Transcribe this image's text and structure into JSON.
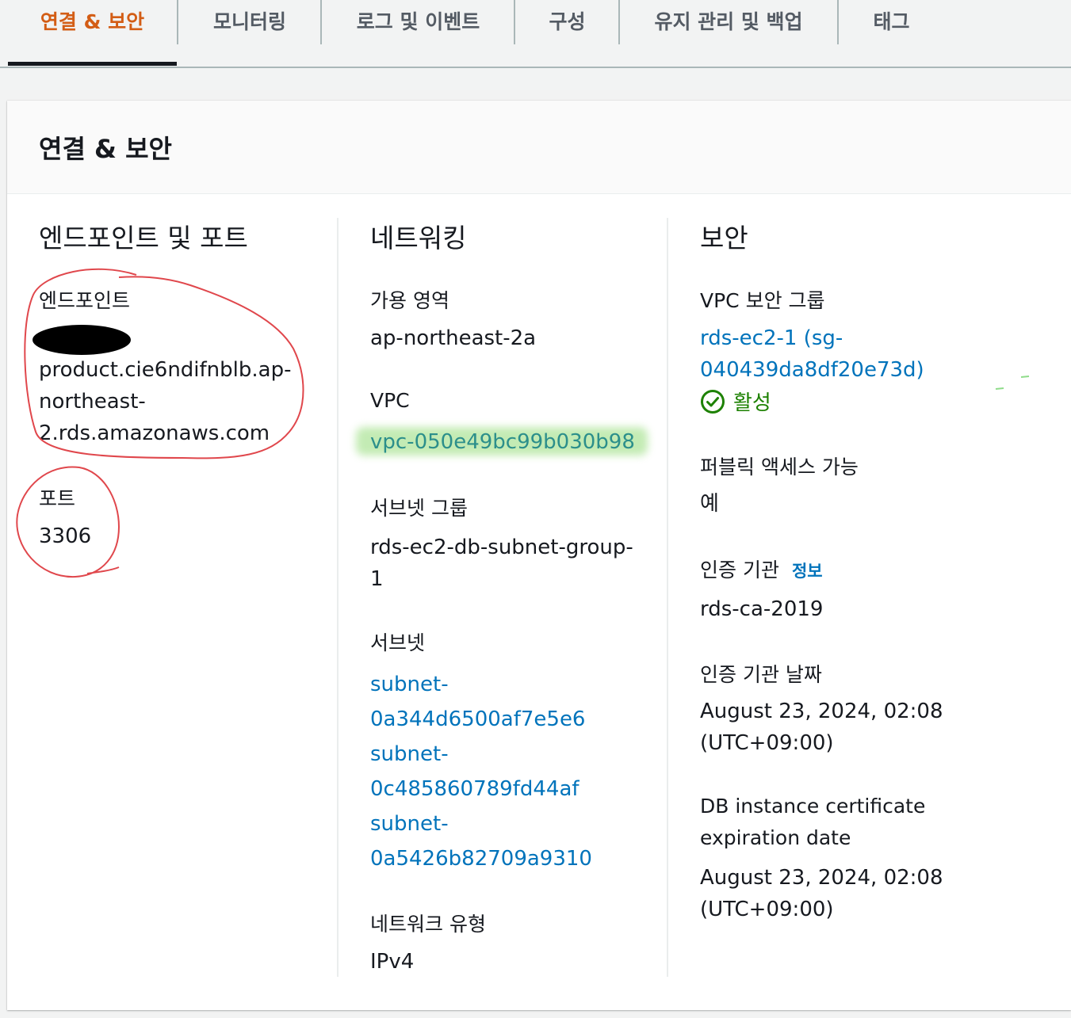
{
  "tabs": [
    {
      "label": "연결 & 보안"
    },
    {
      "label": "모니터링"
    },
    {
      "label": "로그 및 이벤트"
    },
    {
      "label": "구성"
    },
    {
      "label": "유지 관리 및 백업"
    },
    {
      "label": "태그"
    }
  ],
  "active_tab": "연결 & 보안",
  "accent_color": "#d35d15",
  "link_color": "#0073bb",
  "status_color": "#1d8102",
  "card": {
    "title": "연결 & 보안",
    "endpoint_section": {
      "title": "엔드포인트 및 포트",
      "endpoint_label": "엔드포인트",
      "endpoint_line1": "product.cie6ndifnblb.ap-",
      "endpoint_line2": "northeast-",
      "endpoint_line3": "2.rds.amazonaws.com",
      "port_label": "포트",
      "port_value": "3306"
    },
    "networking_section": {
      "title": "네트워킹",
      "az_label": "가용 영역",
      "az_value": "ap-northeast-2a",
      "vpc_label": "VPC",
      "vpc_value": "vpc-050e49bc99b030b98",
      "subnet_group_label": "서브넷 그룹",
      "subnet_group_line1": "rds-ec2-db-subnet-group-",
      "subnet_group_line2": "1",
      "subnet_label": "서브넷",
      "subnets": [
        {
          "line1": "subnet-",
          "line2": "0a344d6500af7e5e6"
        },
        {
          "line1": "subnet-",
          "line2": "0c485860789fd44af"
        },
        {
          "line1": "subnet-",
          "line2": "0a5426b82709a9310"
        }
      ],
      "network_type_label": "네트워크 유형",
      "network_type_value": "IPv4"
    },
    "security_section": {
      "title": "보안",
      "vpc_sg_label": "VPC 보안 그룹",
      "sg_line1": "rds-ec2-1 (sg-",
      "sg_line2": "040439da8df20e73d)",
      "sg_status": "활성",
      "sg_status_icon": "check-circle-icon",
      "public_access_label": "퍼블릭 액세스 가능",
      "public_access_value": "예",
      "ca_label": "인증 기관",
      "ca_info": "정보",
      "ca_value": "rds-ca-2019",
      "ca_date_label": "인증 기관 날짜",
      "ca_date_line1": "August 23, 2024, 02:08",
      "ca_date_line2": "(UTC+09:00)",
      "cert_exp_label_line1": "DB instance certificate",
      "cert_exp_label_line2": "expiration date",
      "cert_exp_line1": "August 23, 2024, 02:08",
      "cert_exp_line2": "(UTC+09:00)"
    }
  }
}
